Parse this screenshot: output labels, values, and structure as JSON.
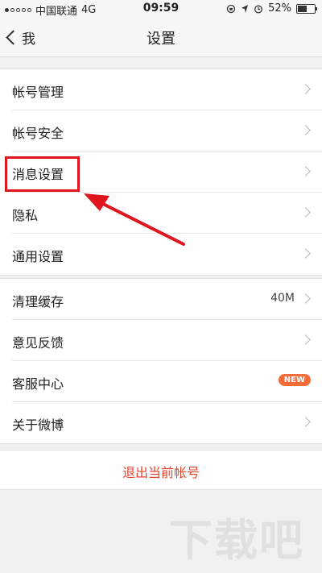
{
  "status_bar": {
    "carrier": "中国联通",
    "network": "4G",
    "time": "09:59",
    "battery": "52%",
    "signal_dots": [
      true,
      false,
      false,
      false,
      false
    ]
  },
  "nav": {
    "back_label": "我",
    "title": "设置"
  },
  "groups": [
    [
      {
        "label": "帐号管理"
      },
      {
        "label": "帐号安全"
      },
      {
        "label": "消息设置"
      },
      {
        "label": "隐私"
      },
      {
        "label": "通用设置"
      }
    ],
    [
      {
        "label": "清理缓存",
        "value": "40M"
      },
      {
        "label": "意见反馈"
      },
      {
        "label": "客服中心",
        "badge": "NEW"
      },
      {
        "label": "关于微博"
      }
    ]
  ],
  "logout_label": "退出当前帐号",
  "watermark": "下载吧",
  "colors": {
    "accent_red": "#e8452c",
    "highlight_red": "#e0141c",
    "badge_orange": "#f26c3a"
  }
}
